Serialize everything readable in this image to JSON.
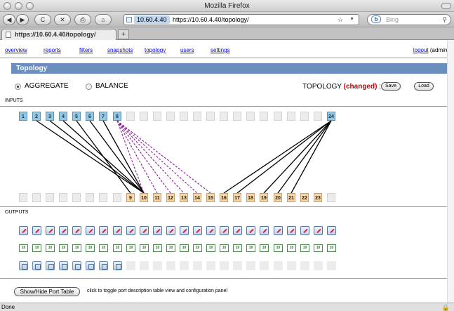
{
  "window": {
    "title": "Mozilla Firefox"
  },
  "toolbar": {
    "back": "◀",
    "forward": "▶",
    "reload": "C",
    "stop": "✕",
    "print": "⎙",
    "home": "⌂",
    "url_domain": "10.60.4.40",
    "url": "https://10.60.4.40/topology/",
    "search_placeholder": "Bing"
  },
  "tab": {
    "label": "https://10.60.4.40/topology/",
    "new_tab": "+"
  },
  "menu": {
    "items": [
      "overview",
      "reports",
      "filters",
      "snapshots",
      "topology",
      "users",
      "settings"
    ],
    "active": "topology",
    "logout": "logout",
    "user": "(admin)"
  },
  "page": {
    "title": "Topology",
    "modes": {
      "aggregate": "AGGREGATE",
      "balance": "BALANCE",
      "selected": "aggregate"
    },
    "topology_label": "TOPOLOGY",
    "changed": "(changed)",
    "colon": ":",
    "save": "Save",
    "load": "Load",
    "inputs_label": "INPUTS",
    "outputs_label": "OUTPUTS"
  },
  "inputs": {
    "labels": [
      "1",
      "2",
      "3",
      "4",
      "5",
      "6",
      "7",
      "8",
      "",
      "",
      "",
      "",
      "",
      "",
      "",
      "",
      "",
      "",
      "",
      "",
      "",
      "",
      "",
      "24"
    ],
    "active": [
      true,
      true,
      true,
      true,
      true,
      true,
      true,
      true,
      false,
      false,
      false,
      false,
      false,
      false,
      false,
      false,
      false,
      false,
      false,
      false,
      false,
      false,
      false,
      true
    ]
  },
  "outputs": {
    "labels": [
      "",
      "",
      "",
      "",
      "",
      "",
      "",
      "",
      "9",
      "10",
      "11",
      "12",
      "13",
      "14",
      "15",
      "16",
      "17",
      "18",
      "19",
      "20",
      "21",
      "22",
      "23",
      ""
    ],
    "active": [
      false,
      false,
      false,
      false,
      false,
      false,
      false,
      false,
      true,
      true,
      true,
      true,
      true,
      true,
      true,
      true,
      true,
      true,
      true,
      true,
      true,
      true,
      true,
      false
    ],
    "speeds": [
      "10",
      "10",
      "10",
      "10",
      "10",
      "10",
      "10",
      "10",
      "10",
      "10",
      "10",
      "10",
      "10",
      "10",
      "10",
      "10",
      "10",
      "10",
      "10",
      "10",
      "10",
      "10",
      "10",
      "10"
    ],
    "config_active": [
      true,
      true,
      true,
      true,
      true,
      true,
      true,
      true,
      false,
      false,
      false,
      false,
      false,
      false,
      false,
      false,
      false,
      false,
      false,
      false,
      false,
      false,
      false,
      false
    ]
  },
  "links": {
    "solid": [
      [
        2,
        10
      ],
      [
        3,
        10
      ],
      [
        4,
        10
      ],
      [
        5,
        9
      ],
      [
        6,
        10
      ],
      [
        7,
        10
      ],
      [
        24,
        16
      ],
      [
        24,
        17
      ],
      [
        24,
        19
      ],
      [
        24,
        20
      ],
      [
        24,
        21
      ]
    ],
    "dashed": [
      [
        8,
        10
      ],
      [
        8,
        11
      ],
      [
        8,
        12
      ],
      [
        8,
        13
      ],
      [
        8,
        14
      ],
      [
        8,
        15
      ]
    ]
  },
  "footer": {
    "toggle": "Show/Hide Port Table",
    "note": "click to toggle port description table view and configuration panel"
  },
  "status": {
    "text": "Done",
    "lock": "🔒"
  },
  "colors": {
    "header": "#6c8ebf",
    "changed": "#cc0000",
    "input_port": "#94c6e2",
    "output_port": "#f6d6a6",
    "solid_link": "#000000",
    "dashed_link": "#8a1a9a"
  }
}
